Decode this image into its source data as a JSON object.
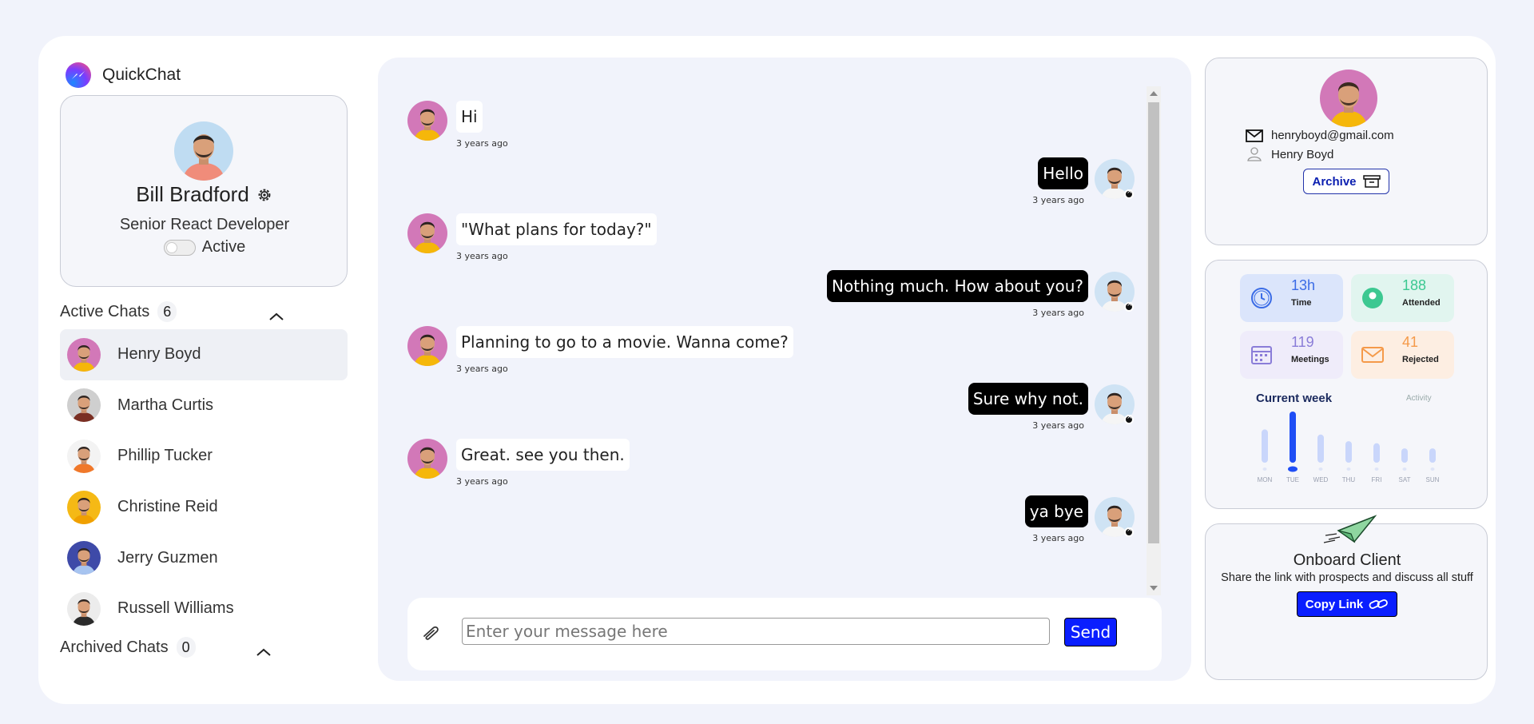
{
  "app": {
    "name": "QuickChat"
  },
  "profile": {
    "name": "Bill Bradford",
    "role": "Senior React Developer",
    "status_label": "Active",
    "status_on": false
  },
  "active_chats": {
    "title": "Active Chats",
    "count": "6",
    "items": [
      {
        "name": "Henry Boyd",
        "selected": true,
        "avatar_bg": "#d278b8",
        "shirt": "#f5b70a"
      },
      {
        "name": "Martha Curtis",
        "avatar_bg": "#cfcfcf",
        "shirt": "#7a2f23"
      },
      {
        "name": "Phillip Tucker",
        "avatar_bg": "#f3f3f3",
        "shirt": "#f0782a"
      },
      {
        "name": "Christine Reid",
        "avatar_bg": "#f5b915",
        "shirt": "#f0a000"
      },
      {
        "name": "Jerry Guzmen",
        "avatar_bg": "#3e4aa8",
        "shirt": "#a7c4f0"
      },
      {
        "name": "Russell Williams",
        "avatar_bg": "#ececec",
        "shirt": "#2b2b2b"
      }
    ]
  },
  "archived_chats": {
    "title": "Archived Chats",
    "count": "0"
  },
  "messages": [
    {
      "dir": "in",
      "text": "Hi",
      "time": "3 years ago"
    },
    {
      "dir": "out",
      "text": "Hello",
      "time": "3 years ago"
    },
    {
      "dir": "in",
      "text": "\"What plans for today?\"",
      "time": "3 years ago"
    },
    {
      "dir": "out",
      "text": "Nothing much. How about you?",
      "time": "3 years ago"
    },
    {
      "dir": "in",
      "text": "Planning to go to a movie. Wanna come?",
      "time": "3 years ago"
    },
    {
      "dir": "out",
      "text": "Sure why not.",
      "time": "3 years ago"
    },
    {
      "dir": "in",
      "text": "Great. see you then.",
      "time": "3 years ago"
    },
    {
      "dir": "out",
      "text": "ya bye",
      "time": "3 years ago"
    }
  ],
  "composer": {
    "placeholder": "Enter your message here",
    "send_label": "Send",
    "attach_icon": "paperclip-icon"
  },
  "contact": {
    "email": "henryboyd@gmail.com",
    "name": "Henry Boyd",
    "archive_label": "Archive"
  },
  "stats": [
    {
      "value": "13h",
      "label": "Time",
      "icon": "clock-icon",
      "bg": "#dbe5fb",
      "color": "#3b6ce6"
    },
    {
      "value": "188",
      "label": "Attended",
      "icon": "user-check-icon",
      "bg": "#e1f5ef",
      "color": "#3cc891"
    },
    {
      "value": "119",
      "label": "Meetings",
      "icon": "calendar-icon",
      "bg": "#efecfa",
      "color": "#8a7dd8"
    },
    {
      "value": "41",
      "label": "Rejected",
      "icon": "mail-icon",
      "bg": "#fdeee2",
      "color": "#f59a4a"
    }
  ],
  "week": {
    "title": "Current week",
    "subtitle": "Activity",
    "days": [
      "MON",
      "TUE",
      "WED",
      "THU",
      "FRI",
      "SAT",
      "SUN"
    ],
    "values": [
      0.65,
      1.0,
      0.55,
      0.42,
      0.38,
      0.28,
      0.28
    ],
    "highlight_index": 1
  },
  "onboard": {
    "title": "Onboard Client",
    "description": "Share the link with prospects and discuss all stuff",
    "button_label": "Copy Link"
  },
  "colors": {
    "accent": "#0a1eff",
    "page_bg": "#f1f3fb",
    "bubble_out": "#000000"
  }
}
